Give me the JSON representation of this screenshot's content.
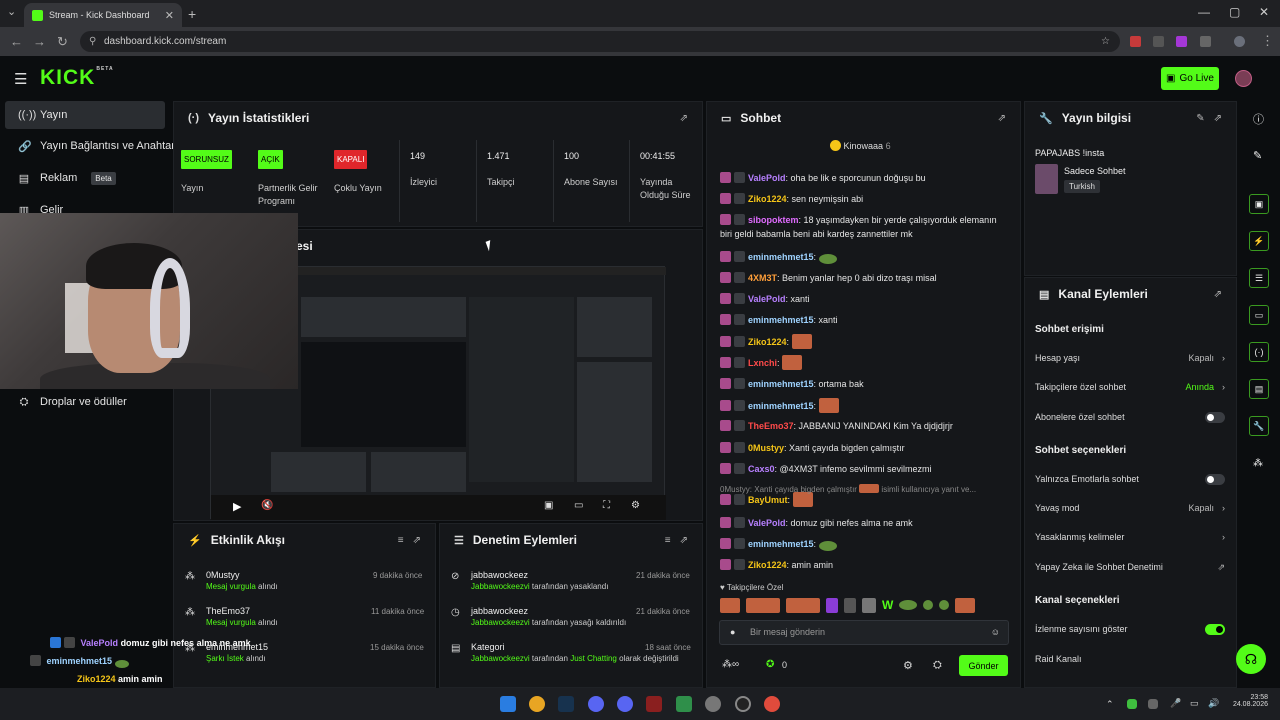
{
  "browser": {
    "tab_title": "Stream - Kick Dashboard",
    "url": "dashboard.kick.com/stream"
  },
  "header": {
    "logo": "KICK",
    "logo_sup": "BETA",
    "go_live": "Go Live"
  },
  "sidebar": {
    "items": [
      {
        "label": "Yayın",
        "icon": "broadcast-icon"
      },
      {
        "label": "Yayın Bağlantısı ve Anahtarı",
        "icon": "link-icon"
      },
      {
        "label": "Reklam",
        "icon": "ad-icon",
        "badge": "Beta"
      },
      {
        "label": "Gelir",
        "icon": "dollar-icon"
      },
      {
        "label": "Droplar ve ödüller",
        "icon": "gift-icon"
      }
    ]
  },
  "stats": {
    "title": "Yayın İstatistikleri",
    "cells": [
      {
        "badge": "SORUNSUZ",
        "badge_color": "#53fc18",
        "label": "Yayın"
      },
      {
        "badge": "AÇIK",
        "badge_color": "#53fc18",
        "label": "Partnerlik Gelir Programı"
      },
      {
        "badge": "KAPALI",
        "badge_color": "#e0262b",
        "label": "Çoklu Yayın"
      },
      {
        "value": "149",
        "label": "İzleyici"
      },
      {
        "value": "1.471",
        "label": "Takipçi"
      },
      {
        "value": "100",
        "label": "Abone Sayısı"
      },
      {
        "value": "00:41:55",
        "label": "Yayında Olduğu Süre"
      }
    ]
  },
  "preview": {
    "title_fragment": "esi"
  },
  "activity": {
    "title": "Etkinlik Akışı",
    "items": [
      {
        "name": "0Mustyy",
        "action": "Mesaj vurgula",
        "suffix": " alındı",
        "time": "9 dakika önce"
      },
      {
        "name": "TheEmo37",
        "action": "Mesaj vurgula",
        "suffix": " alındı",
        "time": "11 dakika önce"
      },
      {
        "name": "eminmehmet15",
        "action": "Şarkı İstek",
        "suffix": " alındı",
        "time": "15 dakika önce"
      }
    ]
  },
  "moderation": {
    "title": "Denetim Eylemleri",
    "items": [
      {
        "name": "jabbawockeez",
        "actor": "Jabbawockeezvi",
        "suffix": " tarafından yasaklandı",
        "time": "21 dakika önce"
      },
      {
        "name": "jabbawockeez",
        "actor": "Jabbawockeezvi",
        "suffix": " tarafından yasağı kaldırıldı",
        "time": "21 dakika önce"
      },
      {
        "name": "Kategori",
        "actor": "Jabbawockeezvi",
        "suffix": " tarafından ",
        "extra": "Just Chatting",
        "extra2": " olarak değiştirildi",
        "time": "18 saat önce"
      }
    ]
  },
  "chat": {
    "title": "Sohbet",
    "pinned_user": "Kinowaaa",
    "pinned_count": "6",
    "messages": [
      {
        "user": "ValePold",
        "color": "#b780ff",
        "text": "oha be lik e sporcunun doğuşu bu"
      },
      {
        "user": "Ziko1224",
        "color": "#f5c518",
        "text": "sen neymişsin abi"
      },
      {
        "user": "sibopoktem",
        "color": "#e06cff",
        "text": "18 yaşımdayken bir yerde çalışıyorduk elemanın biri geldi babamla beni abi kardeş zannettiler mk"
      },
      {
        "user": "eminmehmet15",
        "color": "#9fd3ff",
        "text": ""
      },
      {
        "user": "4XM3T",
        "color": "#ff9f3a",
        "text": "Benim yanlar hep 0 abi dizo traşı misal"
      },
      {
        "user": "ValePold",
        "color": "#b780ff",
        "text": "xanti"
      },
      {
        "user": "eminmehmet15",
        "color": "#9fd3ff",
        "text": "xanti"
      },
      {
        "user": "Ziko1224",
        "color": "#f5c518",
        "text": ""
      },
      {
        "user": "Lxnchi",
        "color": "#ff4a4a",
        "text": ""
      },
      {
        "user": "eminmehmet15",
        "color": "#9fd3ff",
        "text": "ortama bak"
      },
      {
        "user": "eminmehmet15",
        "color": "#9fd3ff",
        "text": ""
      },
      {
        "user": "TheEmo37",
        "color": "#ff4a4a",
        "text": "JABBANIJ YANINDAKI Kim Ya djdjdjrjr"
      },
      {
        "user": "0Mustyy",
        "color": "#f5c518",
        "text": "Xanti çayıda bigden çalmıştır"
      },
      {
        "user": "Caxs0",
        "color": "#b780ff",
        "text": "@4XM3T infemo sevilmmi sevilmezmi"
      },
      {
        "user": "BayUmut",
        "color": "#f5c518",
        "text": ""
      },
      {
        "user": "ValePold",
        "color": "#b780ff",
        "text": "domuz gibi nefes alma ne amk"
      },
      {
        "user": "eminmehmet15",
        "color": "#9fd3ff",
        "text": ""
      },
      {
        "user": "Ziko1224",
        "color": "#f5c518",
        "text": "amin amin"
      }
    ],
    "reply_line": "0Mustyy: Xanti çayıda bigden çalmıştır",
    "reply_suffix": "isimli kullanıcıya yanıt ve...",
    "followers_label": "Takipçilere Özel",
    "input_placeholder": "Bir mesaj gönderin",
    "points": "0",
    "send": "Gönder"
  },
  "stream_info": {
    "title": "Yayın bilgisi",
    "stream_title": "PAPAJABS !insta",
    "category": "Sadece Sohbet",
    "language": "Turkish"
  },
  "channel_actions": {
    "title": "Kanal Eylemleri",
    "chat_access": "Sohbet erişimi",
    "account_age": "Hesap yaşı",
    "account_age_value": "Kapalı",
    "followers_only": "Takipçilere özel sohbet",
    "followers_only_value": "Anında",
    "subs_only": "Abonelere özel sohbet",
    "chat_options": "Sohbet seçenekleri",
    "emote_only": "Yalnızca Emotlarla sohbet",
    "slow_mode": "Yavaş mod",
    "slow_mode_value": "Kapalı",
    "banned_words": "Yasaklanmış kelimeler",
    "ai_moderation": "Yapay Zeka ile Sohbet Denetimi",
    "channel_options": "Kanal seçenekleri",
    "show_viewers": "İzlenme sayısını göster",
    "raid": "Raid Kanalı"
  },
  "overlay_chat": [
    {
      "user": "ValePold",
      "color": "#b780ff",
      "text": "domuz gibi nefes alma ne amk"
    },
    {
      "user": "eminmehmet15",
      "color": "#9fd3ff",
      "text": ""
    },
    {
      "user": "Ziko1224",
      "color": "#f5c518",
      "text": "amin amin"
    }
  ],
  "taskbar": {
    "time": "23:58",
    "date": "24.08.2026"
  }
}
